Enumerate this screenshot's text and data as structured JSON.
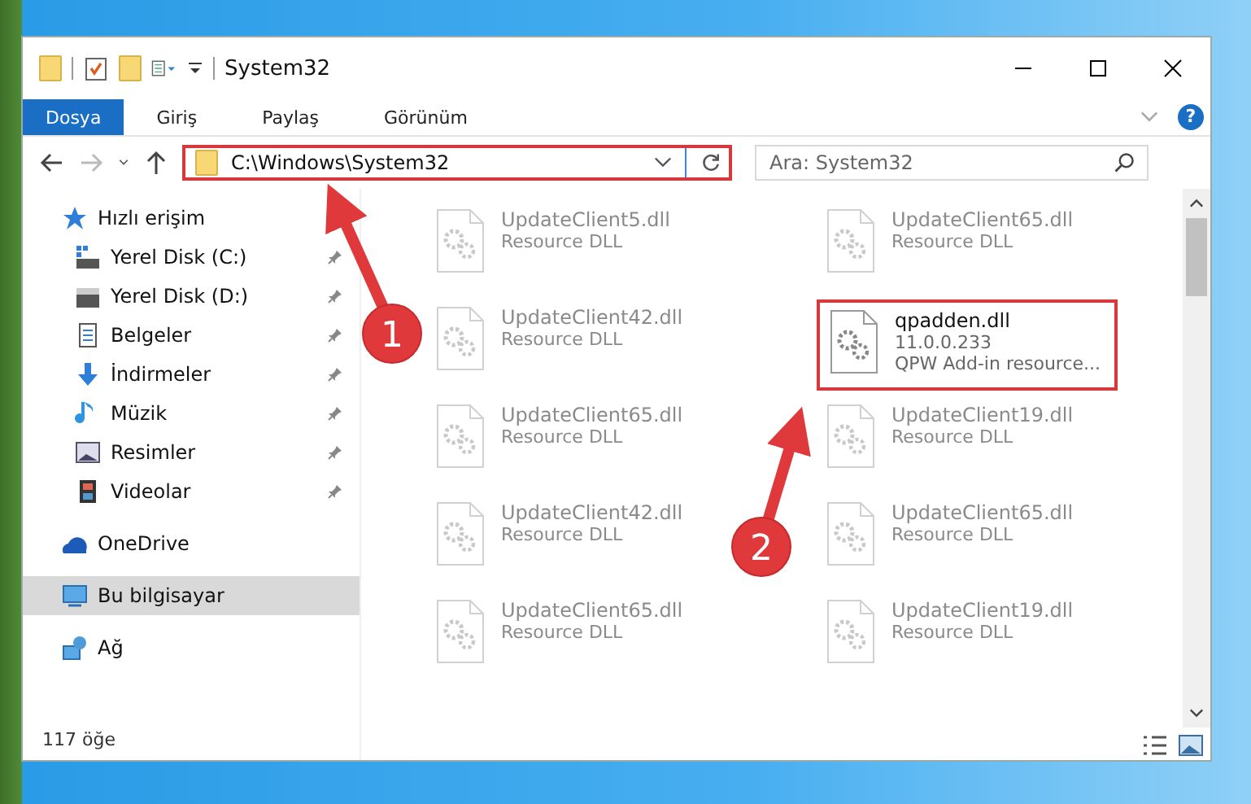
{
  "window": {
    "title": "System32"
  },
  "ribbon_tabs": [
    {
      "label": "Dosya",
      "selected": true
    },
    {
      "label": "Giriş",
      "selected": false
    },
    {
      "label": "Paylaş",
      "selected": false
    },
    {
      "label": "Görünüm",
      "selected": false
    }
  ],
  "help": {
    "label": "?"
  },
  "address": {
    "value": "C:\\Windows\\System32",
    "highlighted": true
  },
  "search": {
    "placeholder": "Ara: System32"
  },
  "sidebar": {
    "items": [
      {
        "label": "Hızlı erişim",
        "selected": false,
        "children": [
          {
            "label": "Yerel Disk (C:)",
            "pinned": true,
            "selected": false
          },
          {
            "label": "Yerel Disk (D:)",
            "pinned": true,
            "selected": false
          },
          {
            "label": "Belgeler",
            "pinned": true,
            "selected": false
          },
          {
            "label": "İndirmeler",
            "pinned": true,
            "selected": false
          },
          {
            "label": "Müzik",
            "pinned": true,
            "selected": false
          },
          {
            "label": "Resimler",
            "pinned": true,
            "selected": false
          },
          {
            "label": "Videolar",
            "pinned": true,
            "selected": false
          }
        ]
      },
      {
        "label": "OneDrive",
        "selected": false
      },
      {
        "label": "Bu bilgisayar",
        "selected": true
      },
      {
        "label": "Ağ",
        "selected": false
      }
    ]
  },
  "files": [
    {
      "name": "UpdateClient5.dll",
      "lines": [
        "Resource DLL"
      ],
      "highlighted": false
    },
    {
      "name": "UpdateClient65.dll",
      "lines": [
        "Resource DLL"
      ],
      "highlighted": false
    },
    {
      "name": "UpdateClient42.dll",
      "lines": [
        "Resource DLL"
      ],
      "highlighted": false
    },
    {
      "name": "qpadden.dll",
      "lines": [
        "11.0.0.233",
        "QPW Add-in resource..."
      ],
      "highlighted": true
    },
    {
      "name": "UpdateClient65.dll",
      "lines": [
        "Resource DLL"
      ],
      "highlighted": false
    },
    {
      "name": "UpdateClient19.dll",
      "lines": [
        "Resource DLL"
      ],
      "highlighted": false
    },
    {
      "name": "UpdateClient42.dll",
      "lines": [
        "Resource DLL"
      ],
      "highlighted": false
    },
    {
      "name": "UpdateClient65.dll",
      "lines": [
        "Resource DLL"
      ],
      "highlighted": false
    },
    {
      "name": "UpdateClient65.dll",
      "lines": [
        "Resource DLL"
      ],
      "highlighted": false
    },
    {
      "name": "UpdateClient19.dll",
      "lines": [
        "Resource DLL"
      ],
      "highlighted": false
    }
  ],
  "status_bar": {
    "count": "117 öğe"
  },
  "annotations": [
    {
      "number": "1"
    },
    {
      "number": "2"
    }
  ]
}
